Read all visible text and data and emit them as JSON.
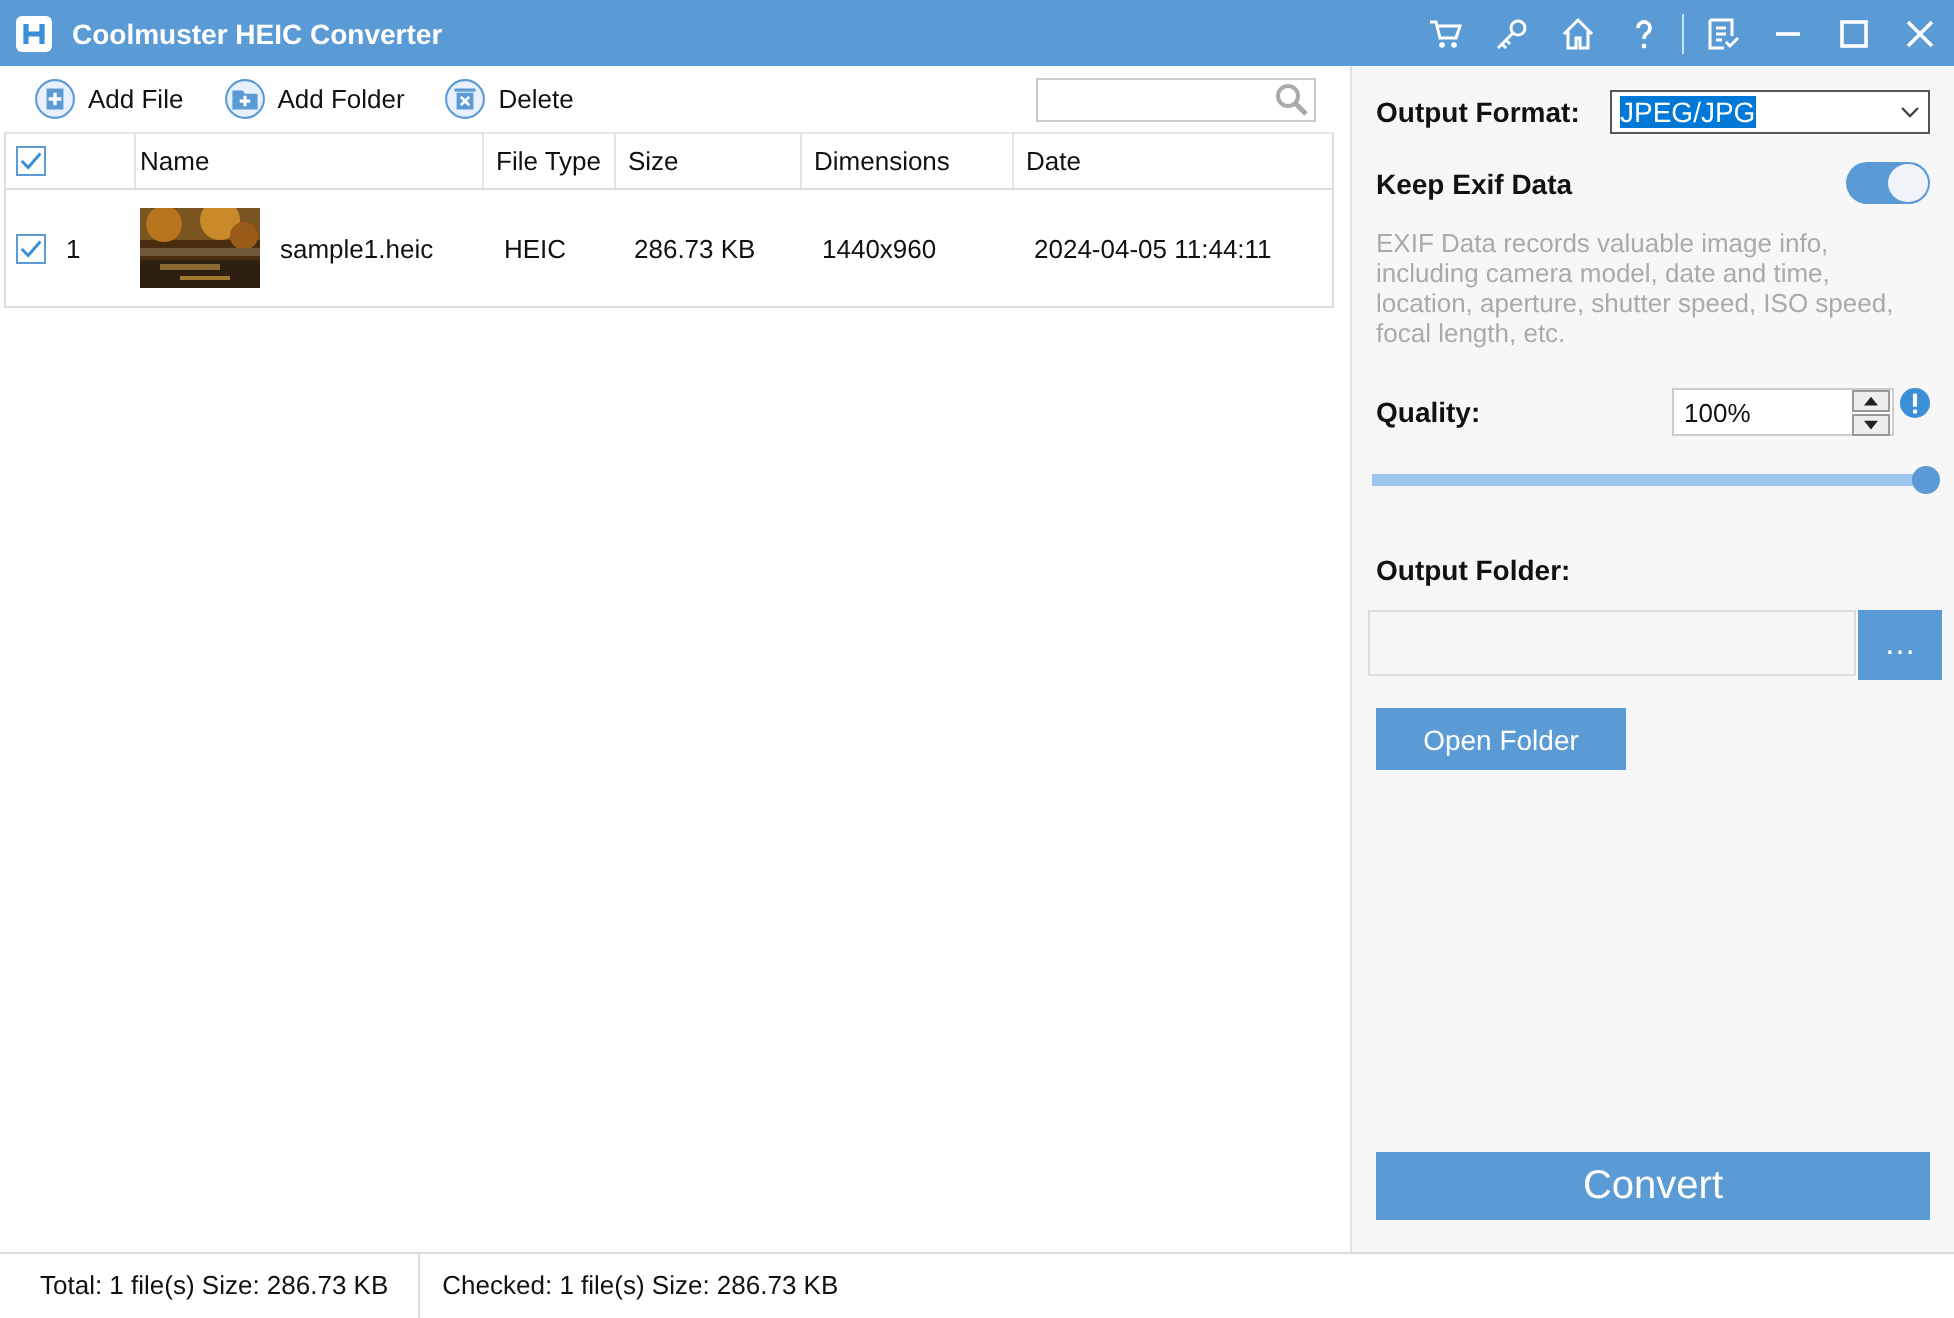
{
  "window": {
    "title": "Coolmuster HEIC Converter"
  },
  "toolbar": [
    {
      "label": "Add File",
      "kind": "add-file"
    },
    {
      "label": "Add Folder",
      "kind": "add-folder"
    },
    {
      "label": "Delete",
      "kind": "delete"
    }
  ],
  "table": {
    "all_checked": true,
    "columns": [
      "Name",
      "File Type",
      "Size",
      "Dimensions",
      "Date"
    ],
    "rows": [
      {
        "checked": true,
        "index": "1",
        "name": "sample1.heic",
        "type": "HEIC",
        "size": "286.73 KB",
        "dimensions": "1440x960",
        "date": "2024-04-05 11:44:11"
      }
    ]
  },
  "settings": {
    "output_format_label": "Output Format:",
    "output_format": "JPEG/JPG",
    "keep_exif_label": "Keep Exif Data",
    "keep_exif": true,
    "exif_note": "EXIF Data records valuable image info, including camera model, date and time, location, aperture, shutter speed, ISO speed, focal length, etc.",
    "quality_label": "Quality:",
    "quality": "100%",
    "quality_slider": {
      "level": 1.0
    },
    "output_folder_label": "Output Folder:",
    "browse": "…",
    "open_folder": "Open Folder",
    "convert": "Convert"
  },
  "status_bar": [
    "Total: 1 file(s) Size: 286.73 KB",
    "Checked: 1 file(s) Size: 286.73 KB"
  ]
}
